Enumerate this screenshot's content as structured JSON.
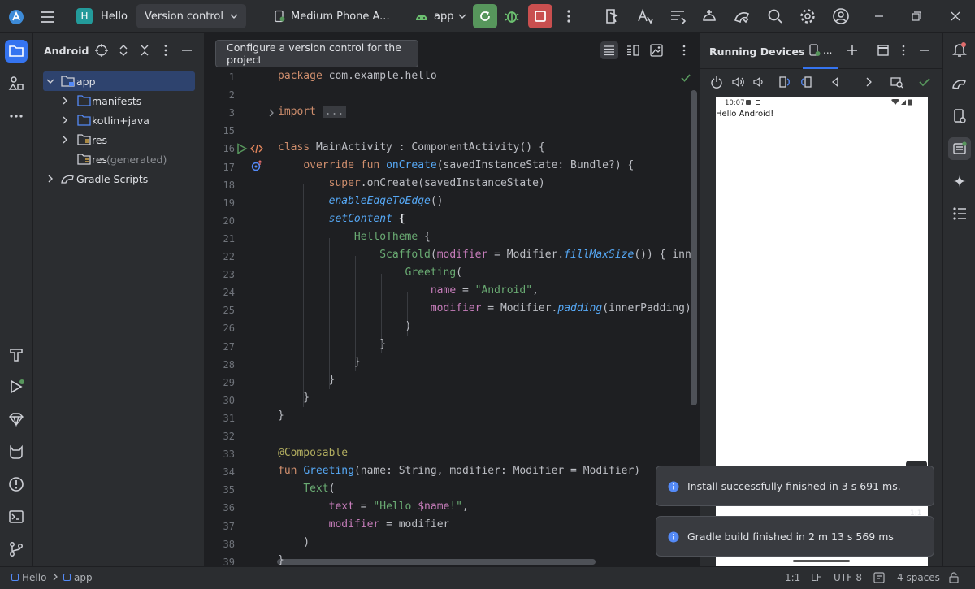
{
  "topbar": {
    "project_initial": "H",
    "project_name": "Hello",
    "vcs_label": "Version control",
    "device_label": "Medium Phone A...",
    "run_config": "app"
  },
  "project_panel": {
    "title": "Android",
    "tree": [
      {
        "label": "app",
        "extra": ""
      },
      {
        "label": "manifests",
        "extra": ""
      },
      {
        "label": "kotlin+java",
        "extra": ""
      },
      {
        "label": "res",
        "extra": ""
      },
      {
        "label": "res",
        "extra": "(generated)"
      },
      {
        "label": "Gradle Scripts",
        "extra": ""
      }
    ]
  },
  "editor": {
    "tooltip": "Configure a version control for the project",
    "line_numbers": [
      "1",
      "2",
      "3",
      "15",
      "16",
      "17",
      "18",
      "19",
      "20",
      "21",
      "22",
      "23",
      "24",
      "25",
      "26",
      "27",
      "28",
      "29",
      "30",
      "31",
      "32",
      "33",
      "34",
      "35",
      "36",
      "37",
      "38",
      "39"
    ]
  },
  "devices": {
    "title": "Running Devices",
    "tab_label": "...",
    "phone_time": "10:07",
    "phone_text": "Hello Android!",
    "scale_label": "1:1"
  },
  "toasts": [
    {
      "text": "Install successfully finished in 3 s 691 ms."
    },
    {
      "text": "Gradle build finished in 2 m 13 s 569 ms"
    }
  ],
  "statusbar": {
    "crumb_project": "Hello",
    "crumb_module": "app",
    "position": "1:1",
    "line_sep": "LF",
    "encoding": "UTF-8",
    "indent": "4 spaces"
  },
  "colors": {
    "accent": "#3574f0",
    "run_green": "#57965c",
    "stop_red": "#c94f4f",
    "selection": "#2e436e"
  }
}
